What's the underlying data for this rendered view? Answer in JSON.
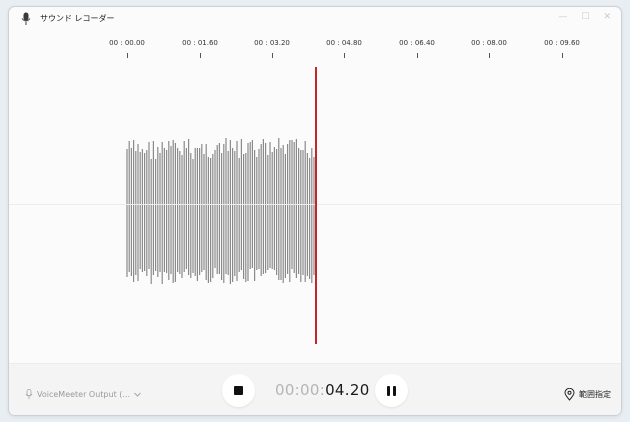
{
  "window": {
    "title": "サウンド レコーダー",
    "controls": [
      "—",
      "☐",
      "✕"
    ]
  },
  "timeline": {
    "ticks": [
      "00 : 00.00",
      "00 : 01.60",
      "00 : 03.20",
      "00 : 04.80",
      "00 : 06.40",
      "00 : 08.00",
      "00 : 09.60"
    ]
  },
  "recording": {
    "timer_prefix": "00:00:",
    "timer_main": "04.20"
  },
  "footer": {
    "device_label": "VoiceMeeter Output (...",
    "marker_label": "範囲指定"
  },
  "colors": {
    "playhead": "#c4262e",
    "waveform": "#8a8a8a"
  },
  "icons": {
    "app": "microphone-icon",
    "device": "microphone-icon",
    "dropdown": "chevron-down-icon",
    "stop": "stop-icon",
    "pause": "pause-icon",
    "marker": "location-pin-icon"
  }
}
